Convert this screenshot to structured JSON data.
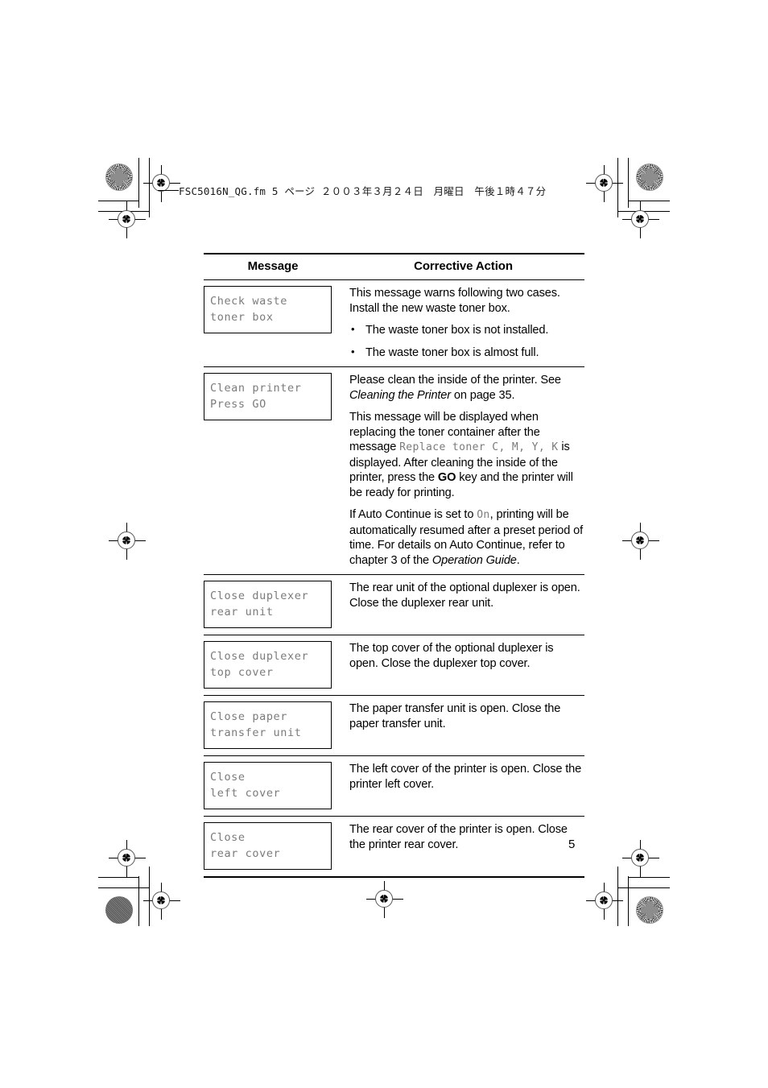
{
  "document": {
    "header_line": "FSC5016N_QG.fm  5 ページ  ２００３年３月２４日　月曜日　午後１時４７分",
    "page_number": "5"
  },
  "table": {
    "headers": {
      "message": "Message",
      "action": "Corrective Action"
    },
    "rows": [
      {
        "lcd": "Check waste\ntoner box",
        "paragraphs": [
          "This message warns following two cases. Install the new waste toner box."
        ],
        "bullets": [
          "The waste toner box is not installed.",
          "The waste toner box is almost full."
        ]
      },
      {
        "lcd": "Clean printer\nPress GO",
        "p1_a": "Please clean the inside of the printer. See ",
        "p1_italic": "Cleaning the Printer",
        "p1_b": " on page 35.",
        "p2_a": "This message will be displayed when replacing the toner container after the message ",
        "p2_mono": "Replace toner C, M, Y, K",
        "p2_b": " is displayed. After cleaning the inside of the printer, press the ",
        "p2_bold": "GO",
        "p2_c": " key and the printer will be ready for printing.",
        "p3_a": "If Auto Continue is set to ",
        "p3_mono": "On",
        "p3_b": ", printing will be automatically resumed after a preset period of time. For details on Auto Continue, refer to chapter 3 of the ",
        "p3_italic": "Operation Guide",
        "p3_c": "."
      },
      {
        "lcd": "Close duplexer\nrear unit",
        "paragraphs": [
          "The rear unit of the optional duplexer is open. Close the duplexer rear unit."
        ],
        "bullets": []
      },
      {
        "lcd": "Close duplexer\ntop cover",
        "paragraphs": [
          "The top cover of the optional duplexer is open. Close the duplexer top cover."
        ],
        "bullets": []
      },
      {
        "lcd": "Close paper\ntransfer unit",
        "paragraphs": [
          "The paper transfer unit is open. Close the paper transfer unit."
        ],
        "bullets": []
      },
      {
        "lcd": "Close\nleft cover",
        "paragraphs": [
          "The left cover of the printer is open. Close the printer left cover."
        ],
        "bullets": []
      },
      {
        "lcd": "Close\nrear cover",
        "paragraphs": [
          "The rear cover of the printer is open. Close the printer rear cover."
        ],
        "bullets": []
      }
    ]
  },
  "colors": {
    "lcd_text": "#7b7b7b",
    "body_text": "#000000",
    "halftone_dot": "#8d8d8d",
    "solid_dot": "#6f6f6f"
  }
}
